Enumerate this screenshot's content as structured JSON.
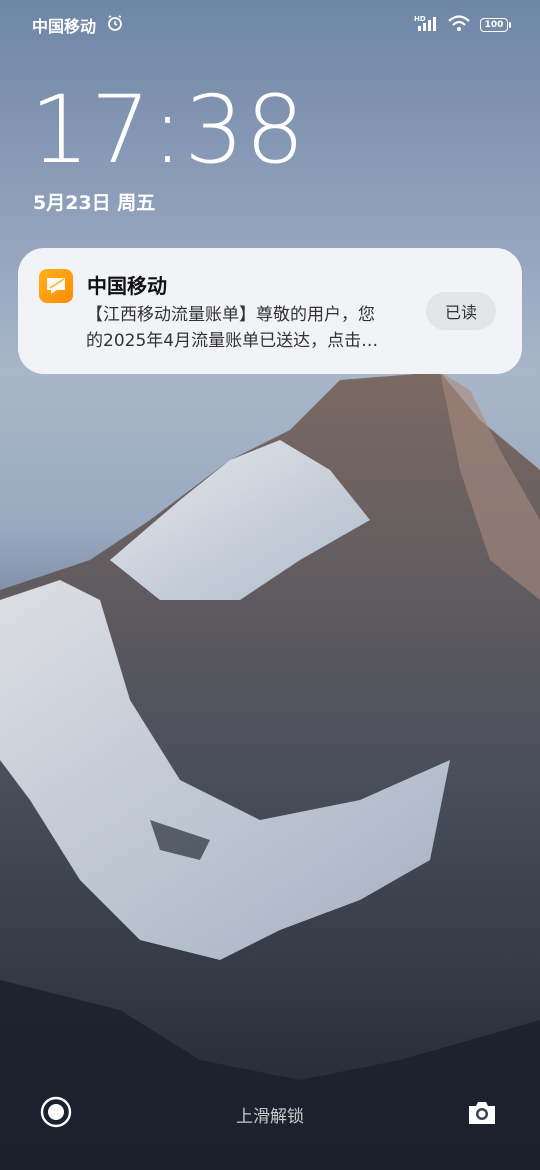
{
  "status_bar": {
    "carrier": "中国移动",
    "battery": "100",
    "hd_label": "HD"
  },
  "lockscreen": {
    "time": "17:38",
    "date": "5月23日 周五",
    "unlock_hint": "上滑解锁"
  },
  "notification": {
    "app_name": "中国移动",
    "body_line1": "【江西移动流量账单】尊敬的用户，您",
    "body_line2": "的2025年4月流量账单已送达，点击…",
    "action_label": "已读"
  },
  "icons": {
    "alarm": "alarm-icon",
    "signal": "signal-icon",
    "wifi": "wifi-icon",
    "battery": "battery-icon",
    "app": "message-icon",
    "left_shortcut": "record-icon",
    "camera": "camera-icon"
  },
  "colors": {
    "app_icon": "#ff9a0f",
    "notification_bg": "#f5f6f8",
    "read_button_bg": "#e2e4e8"
  }
}
